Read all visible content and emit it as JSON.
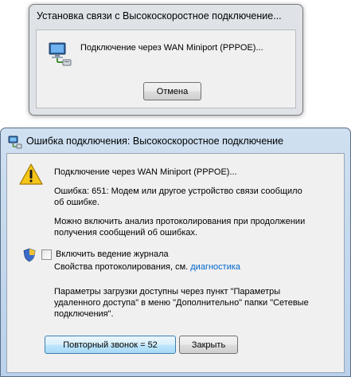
{
  "dialog_connecting": {
    "title": "Установка связи с Высокоскоростное подключение...",
    "message": "Подключение через WAN Miniport (PPPOE)...",
    "cancel_label": "Отмена",
    "icon": "network-computer-icon"
  },
  "dialog_error": {
    "title": "Ошибка подключения: Высокоскоростное подключение",
    "title_icon": "network-connection-icon",
    "warning_icon": "warning-icon",
    "device_text": "Подключение через WAN Miniport (PPPOE)...",
    "error_line1": "Ошибка: 651: Модем или другое устройство связи сообщило",
    "error_line2": "об ошибке.",
    "trace_line1": "Можно включить анализ протоколирования при продолжении",
    "trace_line2": "получения сообщений об ошибках.",
    "logging_checkbox_label": "Включить ведение журнала",
    "logging_checked": false,
    "props_text": "Свойства протоколирования, см.",
    "diagnostics_link": "диагностика",
    "params_line1": "Параметры загрузки доступны через пункт \"Параметры",
    "params_line2": "удаленного доступа\" в меню \"Дополнительно\" папки \"Сетевые",
    "params_line3": "подключения\".",
    "redial_label": "Повторный звонок = 52",
    "close_label": "Закрыть"
  },
  "colors": {
    "link": "#0066cc",
    "title_bar": "#b9d1ea",
    "client_bg": "#f0f0f0"
  }
}
